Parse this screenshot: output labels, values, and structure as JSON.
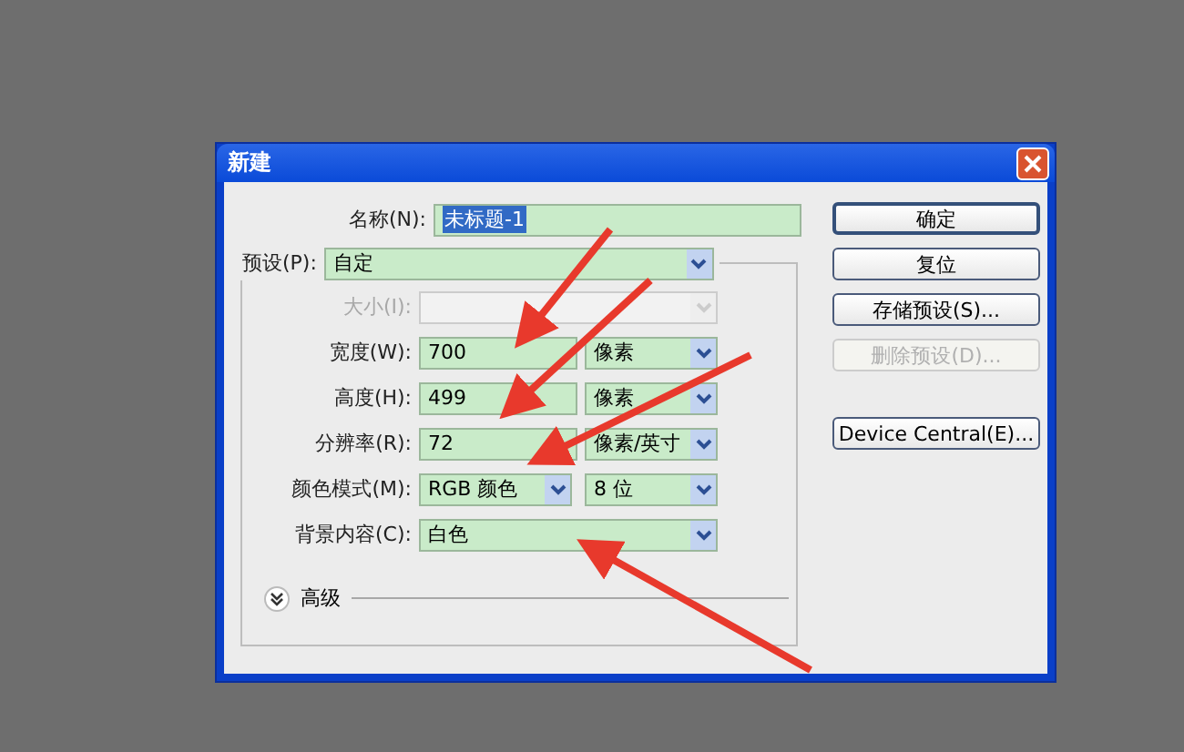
{
  "window": {
    "title": "新建"
  },
  "name_row": {
    "label": "名称(N):",
    "value": "未标题-1",
    "selected": true
  },
  "preset_row": {
    "label": "预设(P):",
    "value": "自定"
  },
  "rows": [
    {
      "kind": "select",
      "label": "大小(I):",
      "disabled": true
    },
    {
      "kind": "number",
      "label": "宽度(W):",
      "value": "700",
      "unit": "像素",
      "disabled": false
    },
    {
      "kind": "number",
      "label": "高度(H):",
      "value": "499",
      "unit": "像素",
      "disabled": false
    },
    {
      "kind": "number",
      "label": "分辨率(R):",
      "value": "72",
      "unit": "像素/英寸",
      "disabled": false
    },
    {
      "kind": "mode",
      "label": "颜色模式(M):",
      "value": "RGB 颜色",
      "unit": "8 位",
      "disabled": false
    },
    {
      "kind": "select",
      "label": "背景内容(C):",
      "value": "白色",
      "disabled": false
    }
  ],
  "advanced": {
    "label": "高级",
    "expanded": false
  },
  "buttons": [
    {
      "label": "确定",
      "default": true,
      "disabled": false
    },
    {
      "label": "复位",
      "default": false,
      "disabled": false
    },
    {
      "label": "存储预设(S)...",
      "default": false,
      "disabled": false
    },
    {
      "label": "删除预设(D)...",
      "default": false,
      "disabled": true
    },
    {
      "label": "Device Central(E)...",
      "default": false,
      "disabled": false
    }
  ]
}
